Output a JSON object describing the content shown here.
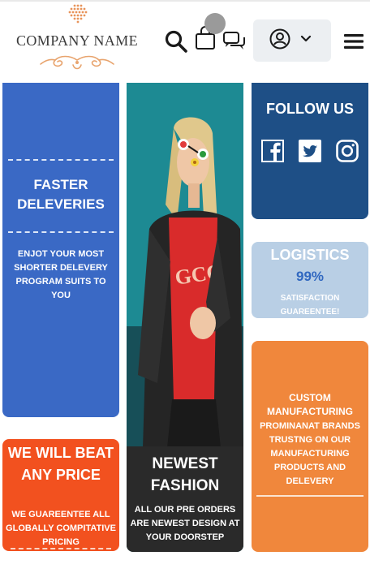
{
  "header": {
    "company_name": "COMPANY NAME",
    "icons": [
      "search-icon",
      "shopping-bag-icon",
      "chat-icon",
      "user-icon",
      "chevron-down-icon",
      "hamburger-menu-icon"
    ]
  },
  "cards": {
    "delivery": {
      "title": "FASTER DELEVERIES",
      "text": "ENJOT YOUR MOST SHORTER DELEVERY PROGRAM SUITS TO YOU",
      "color": "#3a69c5"
    },
    "price": {
      "title": "WE WILL BEAT ANY PRICE",
      "text": "WE GUAREENTEE ALL GLOBALLY COMPITATIVE PRICING",
      "color": "#f2511f"
    },
    "fashion": {
      "title": "NEWEST FASHION",
      "text": "ALL OUR PRE ORDERS ARE NEWEST DESIGN AT YOUR DOORSTEP",
      "color": "#2a2a2a"
    },
    "follow": {
      "title": "FOLLOW US",
      "socials": [
        "facebook-icon",
        "twitter-icon",
        "instagram-icon"
      ],
      "color": "#1e4f86"
    },
    "logistics": {
      "title": "LOGISTICS",
      "percent": "99%",
      "text": "SATISFACTION GUAREENTEE!",
      "color": "#b9cfe5"
    },
    "manufacturing": {
      "title": "CUSTOM MANUFACTURING",
      "text": "PROMINANAT BRANDS TRUSTNG ON OUR MANUFACTURING PRODUCTS AND DELEVERY",
      "color": "#f0873c"
    }
  }
}
